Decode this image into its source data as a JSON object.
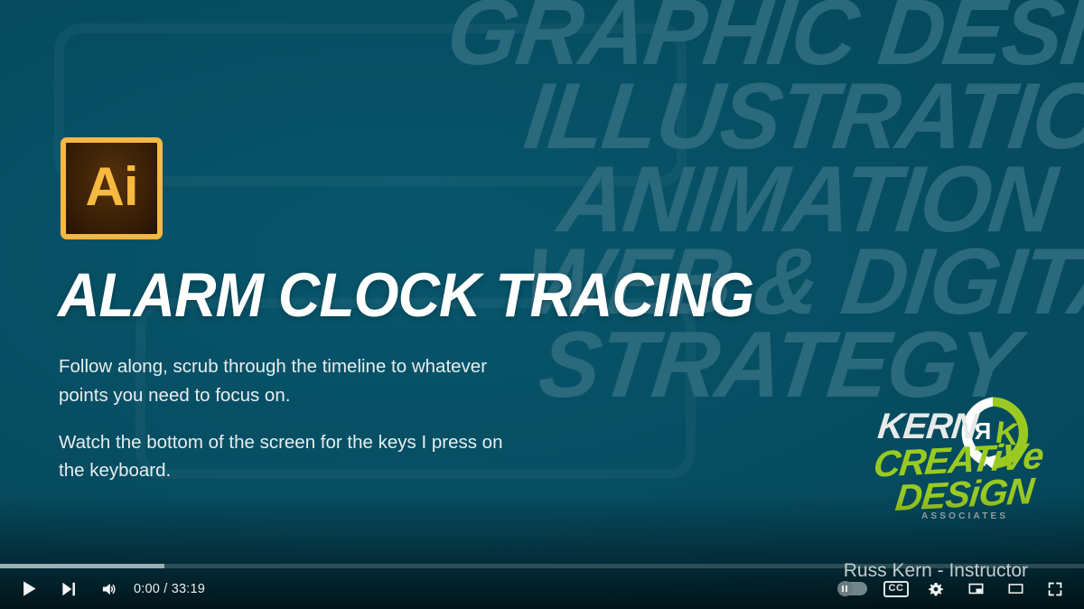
{
  "player": {
    "time_display": "0:00 / 33:19",
    "current_time": "0:00",
    "duration": "33:19",
    "progress_percent": 0,
    "loaded_percent": 15.2,
    "uploader_credit": "Russ Kern - Instructor",
    "controls": {
      "play": "Play",
      "next": "Next",
      "volume": "Mute",
      "autoplay": "Autoplay is off",
      "captions": "CC",
      "settings": "Settings",
      "miniplayer": "Miniplayer",
      "theater": "Theater mode",
      "fullscreen": "Full screen"
    }
  },
  "slide": {
    "app_badge": "Ai",
    "headline": "ALARM CLOCK TRACING",
    "paragraphs": [
      "Follow along, scrub through the timeline to whatever points you need to focus on.",
      "Watch the bottom of the screen for the keys I press on the keyboard."
    ],
    "watermark_lines": [
      "GRaPHiC DESiGN",
      "iLLUSTRATiON",
      "ANiMATiON",
      "WeB & DiGiTaL",
      "STRATEGY"
    ],
    "logo": {
      "kern": "KERN",
      "creative": "CREATiVe",
      "design": "DESiGN",
      "associates": "ASSOCIATES"
    },
    "colors": {
      "background": "#044B60",
      "watermark": "#2A6A7C",
      "headline": "#FFFFFF",
      "body_text": "#E7EEF0",
      "badge_border": "#F4B844",
      "badge_fill": "#3A2006",
      "badge_text": "#F7B93F",
      "logo_green": "#9ACA21",
      "logo_light": "#E6EAE8"
    }
  }
}
